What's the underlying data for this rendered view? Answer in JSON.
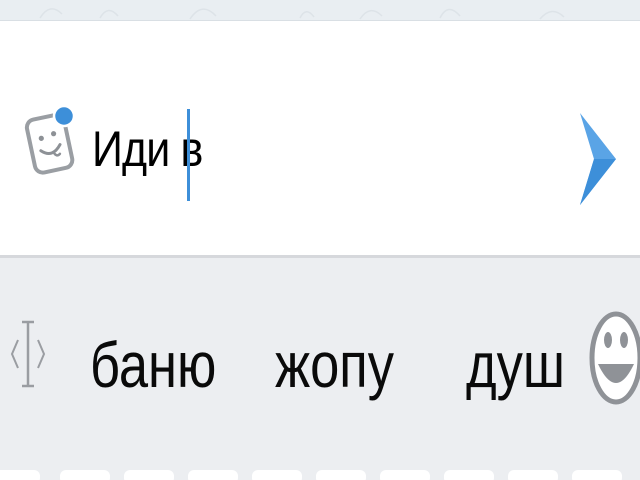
{
  "composer": {
    "message_text": "Иди в",
    "sticker_icon": "sticker-icon",
    "send_icon": "send-arrow-icon",
    "accent_color": "#3d8fd9",
    "badge_color": "#3d8fd9"
  },
  "keyboard": {
    "cursor_icon": "text-cursor-icon",
    "emoji_icon": "smiley-icon",
    "suggestions": [
      "баню",
      "жопу",
      "душ"
    ]
  }
}
